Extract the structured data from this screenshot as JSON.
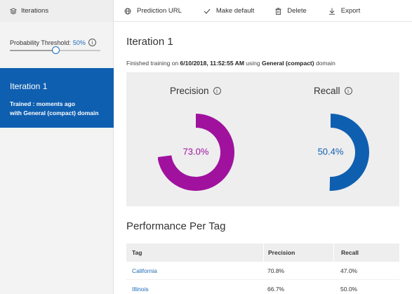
{
  "header": {
    "iterations_label": "Iterations",
    "toolbar": {
      "prediction_url": "Prediction URL",
      "make_default": "Make default",
      "delete": "Delete",
      "export": "Export"
    }
  },
  "sidebar": {
    "threshold_label": "Probability Threshold:",
    "threshold_value": "50%",
    "threshold_fraction": 0.5,
    "iteration": {
      "title": "Iteration 1",
      "line1": "Trained : moments ago",
      "line2": "with General (compact) domain"
    }
  },
  "main": {
    "title": "Iteration 1",
    "finished_prefix": "Finished training on ",
    "finished_date": "6/10/2018, 11:52:55 AM",
    "finished_mid": " using ",
    "finished_domain": "General (compact)",
    "finished_suffix": " domain",
    "precision": {
      "label": "Precision",
      "value_text": "73.0%",
      "value": 73.0,
      "color": "#a0129e"
    },
    "recall": {
      "label": "Recall",
      "value_text": "50.4%",
      "value": 50.4,
      "color": "#0f5fb0"
    },
    "performance_title": "Performance Per Tag",
    "table": {
      "headers": [
        "Tag",
        "Precision",
        "Recall"
      ],
      "rows": [
        {
          "tag": "California",
          "precision": "70.8%",
          "recall": "47.0%"
        },
        {
          "tag": "Illinois",
          "precision": "66.7%",
          "recall": "50.0%"
        }
      ]
    }
  },
  "colors": {
    "accent": "#0f5fb0",
    "precision": "#a0129e",
    "link": "#1f6bb8"
  }
}
